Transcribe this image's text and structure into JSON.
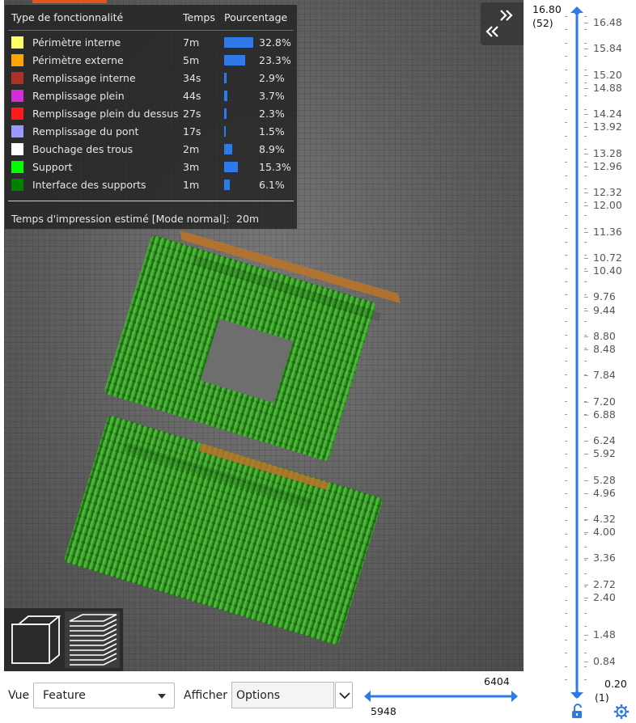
{
  "legend": {
    "headers": {
      "type": "Type de fonctionnalité",
      "time": "Temps",
      "percent": "Pourcentage"
    },
    "rows": [
      {
        "name": "Périmètre interne",
        "time": "7m",
        "percent": "32.8%",
        "fraction": 0.328,
        "color": "#ffff66"
      },
      {
        "name": "Périmètre externe",
        "time": "5m",
        "percent": "23.3%",
        "fraction": 0.233,
        "color": "#ffa500"
      },
      {
        "name": "Remplissage interne",
        "time": "34s",
        "percent": "2.9%",
        "fraction": 0.029,
        "color": "#b03029"
      },
      {
        "name": "Remplissage plein",
        "time": "44s",
        "percent": "3.7%",
        "fraction": 0.037,
        "color": "#d22dd6"
      },
      {
        "name": "Remplissage plein du dessus",
        "time": "27s",
        "percent": "2.3%",
        "fraction": 0.023,
        "color": "#ff1a1a"
      },
      {
        "name": "Remplissage du pont",
        "time": "17s",
        "percent": "1.5%",
        "fraction": 0.015,
        "color": "#9999ff"
      },
      {
        "name": "Bouchage des trous",
        "time": "2m",
        "percent": "8.9%",
        "fraction": 0.089,
        "color": "#ffffff"
      },
      {
        "name": "Support",
        "time": "3m",
        "percent": "15.3%",
        "fraction": 0.153,
        "color": "#00ff00"
      },
      {
        "name": "Interface des supports",
        "time": "1m",
        "percent": "6.1%",
        "fraction": 0.061,
        "color": "#008000"
      }
    ],
    "estimate_label": "Temps d'impression estimé [Mode normal]:",
    "estimate_value": "20m"
  },
  "vertical_slider": {
    "top_value": "16.80",
    "top_layer": "(52)",
    "bottom_value": "0.20",
    "bottom_layer": "(1)",
    "ticks": [
      "16.48",
      "15.84",
      "15.20",
      "14.88",
      "14.24",
      "13.92",
      "13.28",
      "12.96",
      "12.32",
      "12.00",
      "11.36",
      "10.72",
      "10.40",
      "9.76",
      "9.44",
      "8.80",
      "8.48",
      "7.84",
      "7.20",
      "6.88",
      "6.24",
      "5.92",
      "5.28",
      "4.96",
      "4.32",
      "4.00",
      "3.36",
      "2.72",
      "2.40",
      "1.48",
      "0.84"
    ]
  },
  "toolbar": {
    "vue_label": "Vue",
    "vue_value": "Feature",
    "afficher_label": "Afficher",
    "options_value": "Options"
  },
  "horizontal_slider": {
    "high": "6404",
    "low": "5948"
  },
  "colors": {
    "accent": "#2d7ae8",
    "model_green": "#2f9a1f",
    "perimeter_orange": "#b8732a",
    "panel_bg": "#222222"
  },
  "icons": {
    "collapse": "double-chevron-icon",
    "view_3d": "cube-icon",
    "view_layers": "layers-icon",
    "lock": "unlock-icon",
    "settings": "gear-icon"
  }
}
